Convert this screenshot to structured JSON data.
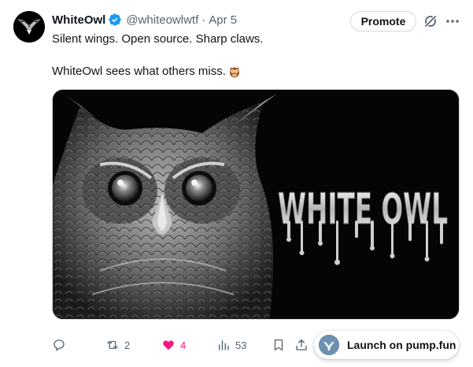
{
  "tweet": {
    "author": {
      "display_name": "WhiteOwl",
      "handle": "@whiteowlwtf",
      "verified": true,
      "avatar_icon": "winged-logo-icon"
    },
    "separator": "·",
    "timestamp": "Apr 5",
    "text_line_1": "Silent wings. Open source. Sharp claws.",
    "text_line_2": "WhiteOwl sees what others miss.",
    "emoji": "owl-emoji",
    "media": {
      "description_icon": "owl-image",
      "title_text": "WHITE OWL"
    }
  },
  "header": {
    "promote_label": "Promote",
    "grok_icon": "grok-icon",
    "more_icon": "more-icon"
  },
  "actions": {
    "reply": {
      "icon": "reply-icon",
      "count": ""
    },
    "repost": {
      "icon": "repost-icon",
      "count": "2"
    },
    "like": {
      "icon": "heart-icon",
      "count": "4",
      "liked": true,
      "color": "#f91880"
    },
    "views": {
      "icon": "views-icon",
      "count": "53"
    },
    "bookmark": {
      "icon": "bookmark-icon"
    },
    "share": {
      "icon": "share-icon"
    }
  },
  "launch": {
    "label": "Launch on pump.fun",
    "icon": "token-avatar-icon"
  },
  "colors": {
    "text": "#0f1419",
    "secondary": "#536471",
    "verified": "#1d9bf0",
    "like": "#f91880",
    "border": "#cfd9de"
  }
}
